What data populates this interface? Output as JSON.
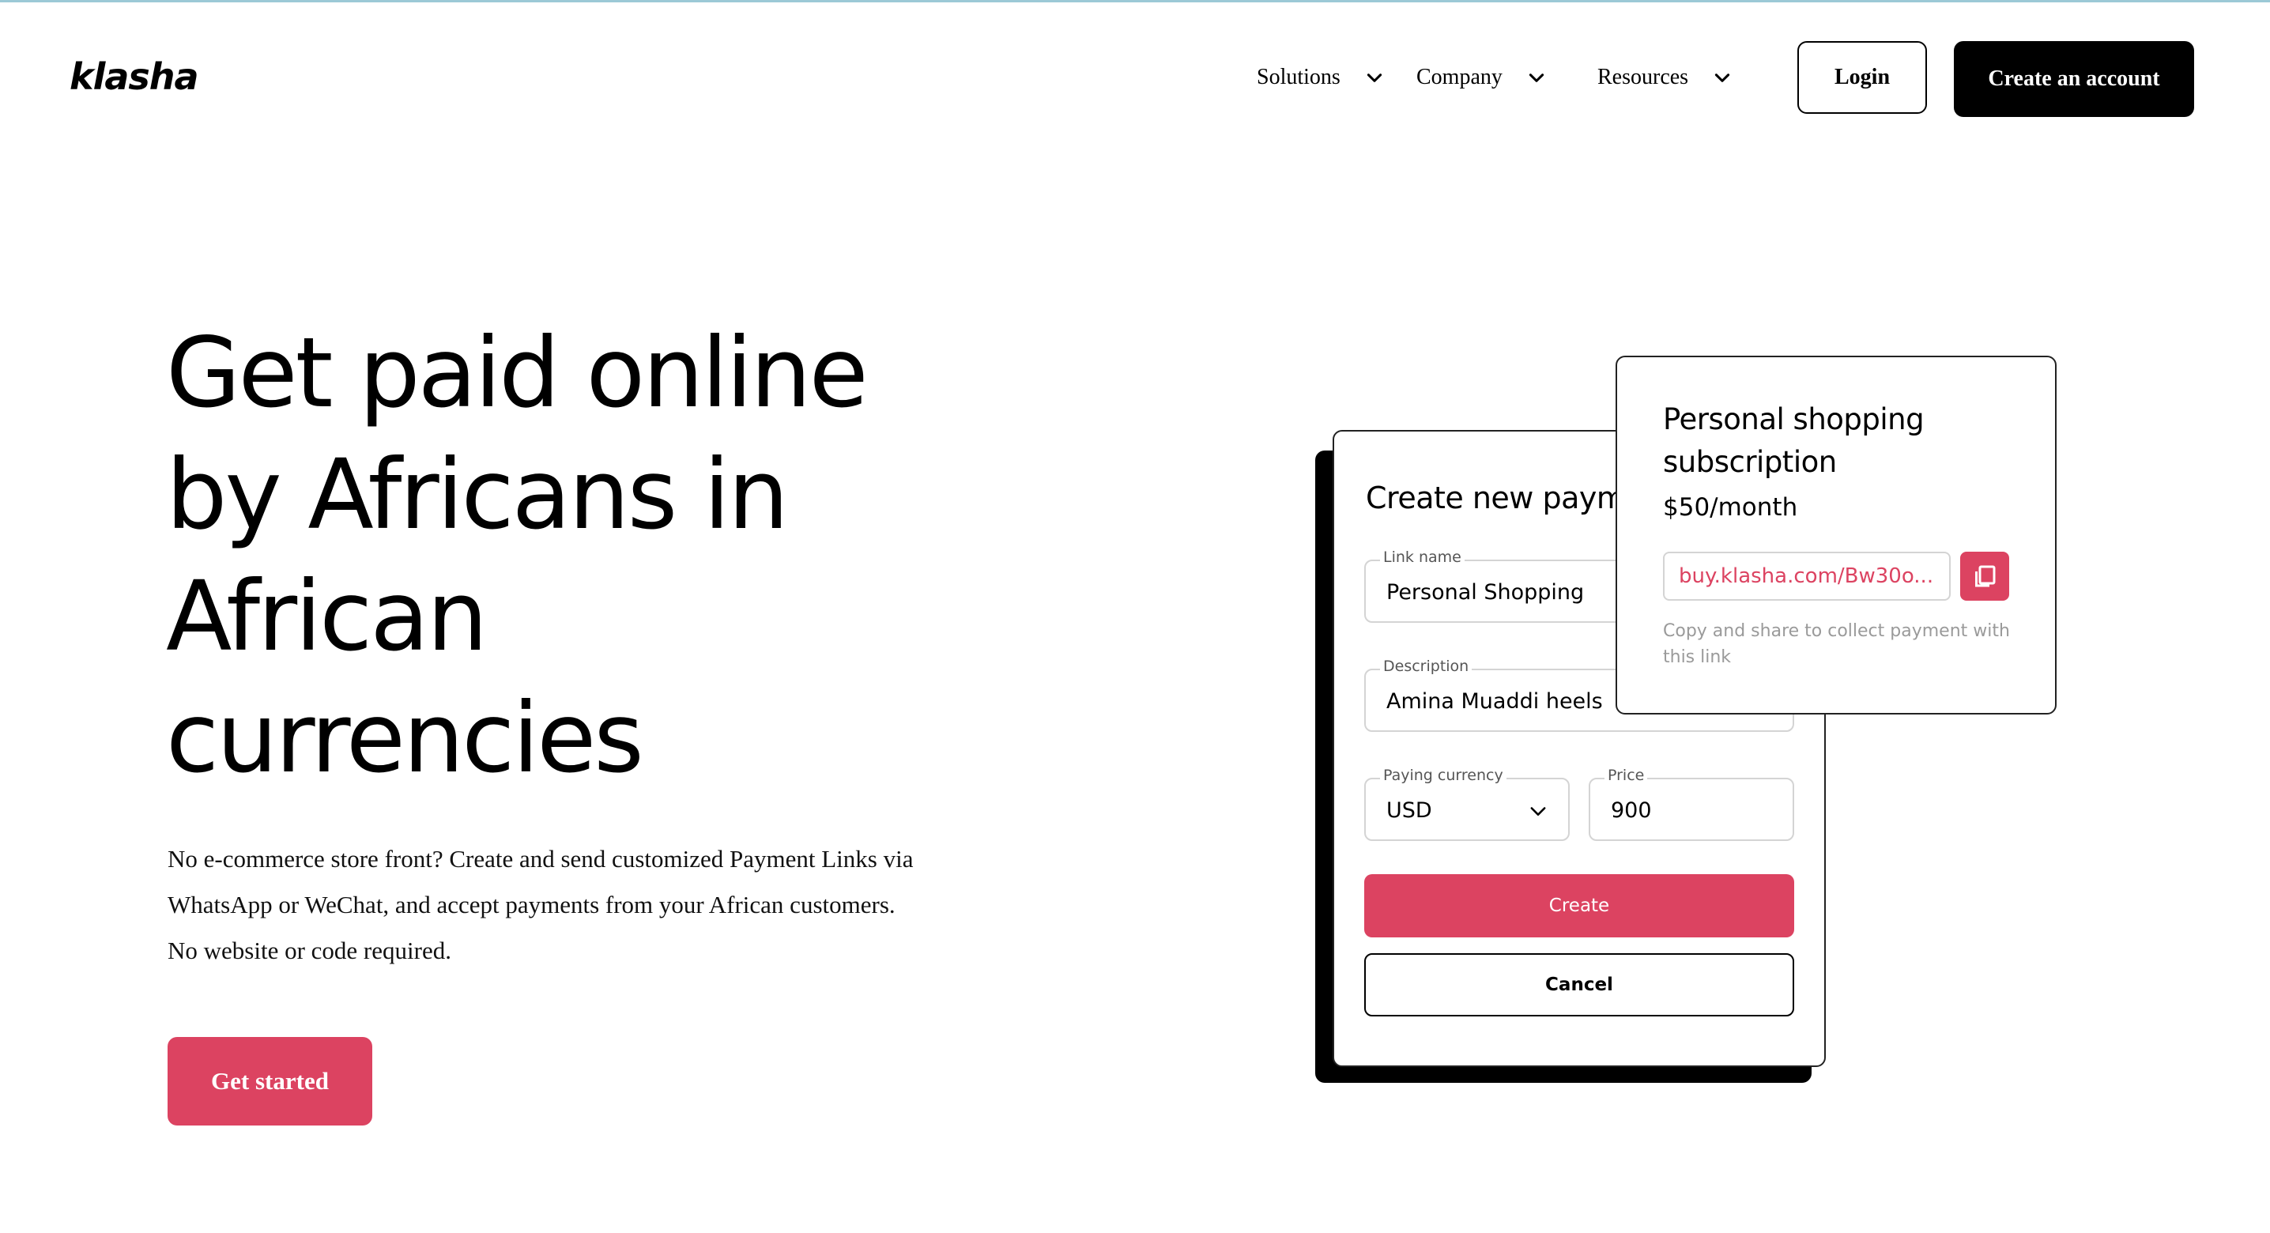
{
  "brand": {
    "logo": "klasha",
    "accent": "#dc4361"
  },
  "nav": {
    "items": [
      {
        "label": "Solutions"
      },
      {
        "label": "Company"
      },
      {
        "label": "Resources"
      }
    ],
    "login_label": "Login",
    "create_account_label": "Create an account"
  },
  "hero": {
    "title_lines": [
      "Get paid online",
      "by Africans in",
      "African",
      "currencies"
    ],
    "description": "No e-commerce store front? Create and send customized Payment Links via WhatsApp or WeChat, and accept payments from your African customers. No website or code required.",
    "cta_label": "Get started"
  },
  "form": {
    "title": "Create new payment link",
    "link_name": {
      "label": "Link name",
      "value": "Personal Shopping"
    },
    "description": {
      "label": "Description",
      "value": "Amina Muaddi heels"
    },
    "currency": {
      "label": "Paying currency",
      "value": "USD"
    },
    "price": {
      "label": "Price",
      "value": "900"
    },
    "create_label": "Create",
    "cancel_label": "Cancel"
  },
  "subscription": {
    "title": "Personal shopping subscription",
    "price": "$50/month",
    "link": "buy.klasha.com/Bw30o...",
    "hint": "Copy and share to collect payment with this link"
  }
}
